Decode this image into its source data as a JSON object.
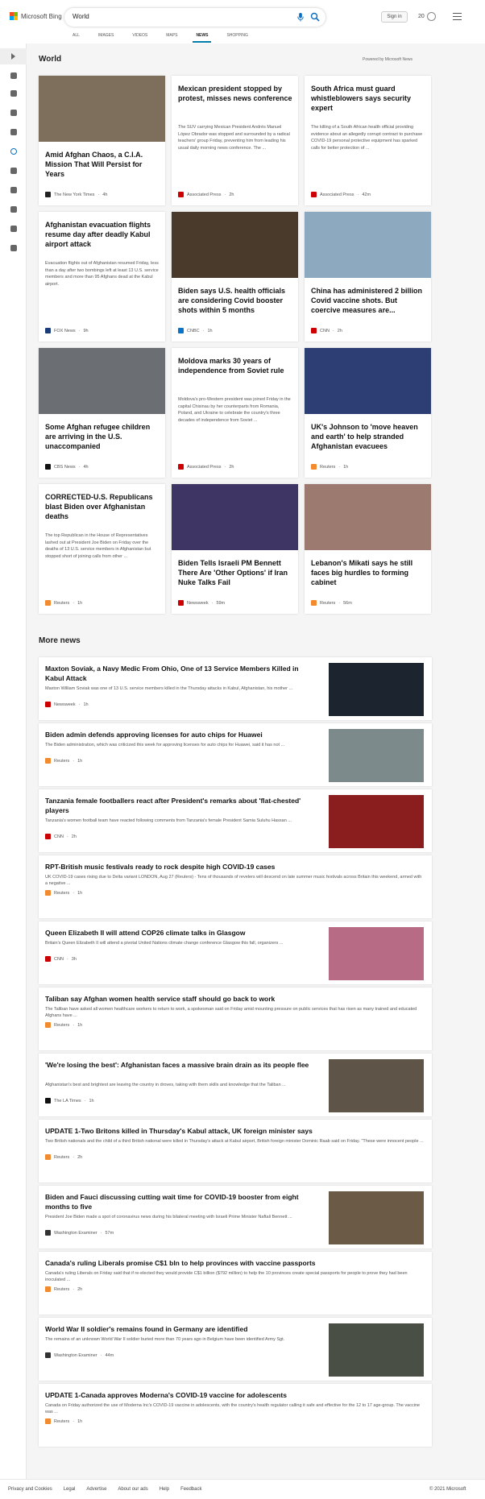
{
  "header": {
    "logo_text": "Microsoft Bing",
    "search_value": "World",
    "signin": "Sign in",
    "rewards_count": "20",
    "tabs": [
      "ALL",
      "IMAGES",
      "VIDEOS",
      "MAPS",
      "NEWS",
      "SHOPPING"
    ],
    "active_tab": "NEWS"
  },
  "world": {
    "title": "World",
    "powered": "Powered by Microsoft News",
    "cards": [
      {
        "title": "Amid Afghan Chaos, a C.I.A. Mission That Will Persist for Years",
        "snippet": "",
        "source": "The New York Times",
        "time": "4h",
        "src_color": "#222",
        "img_color": "#7d6f5b",
        "has_img": true
      },
      {
        "title": "Mexican president stopped by protest, misses news conference",
        "snippet": "The SUV carrying Mexican President Andrés Manuel López Obrador was stopped and surrounded by a radical teachers' group Friday, preventing him from leading his usual daily morning news conference. The ...",
        "source": "Associated Press",
        "time": "2h",
        "src_color": "#c00",
        "has_img": false
      },
      {
        "title": "South Africa must guard whistleblowers says security expert",
        "snippet": "The killing of a South African health official providing evidence about an allegedly corrupt contract to purchase COVID-19 personal protective equipment has sparked calls for better protection of ...",
        "source": "Associated Press",
        "time": "42m",
        "src_color": "#c00",
        "has_img": false
      },
      {
        "title": "Afghanistan evacuation flights resume day after deadly Kabul airport attack",
        "snippet": "Evacuation flights out of Afghanistan resumed Friday, less than a day after two bombings left at least 13 U.S. service members and more than 95 Afghans dead at the Kabul airport.",
        "source": "FOX News",
        "time": "9h",
        "src_color": "#1a3d7a",
        "has_img": false
      },
      {
        "title": "Biden says U.S. health officials are considering Covid booster shots within 5 months",
        "snippet": "",
        "source": "CNBC",
        "time": "1h",
        "src_color": "#0a72c7",
        "img_color": "#4a3a2c",
        "has_img": true
      },
      {
        "title": "China has administered 2 billion Covid vaccine shots. But coercive measures are...",
        "snippet": "",
        "source": "CNN",
        "time": "2h",
        "src_color": "#c00",
        "img_color": "#8da9c0",
        "has_img": true
      },
      {
        "title": "Some Afghan refugee children are arriving in the U.S. unaccompanied",
        "snippet": "",
        "source": "CBS News",
        "time": "4h",
        "src_color": "#111",
        "img_color": "#6b6e72",
        "has_img": true
      },
      {
        "title": "Moldova marks 30 years of independence from Soviet rule",
        "snippet": "Moldova's pro-Western president was joined Friday in the capital Chisinau by her counterparts from Romania, Poland, and Ukraine to celebrate the country's three decades of independence from Soviet ...",
        "source": "Associated Press",
        "time": "2h",
        "src_color": "#c00",
        "has_img": false
      },
      {
        "title": "UK's Johnson to 'move heaven and earth' to help stranded Afghanistan evacuees",
        "snippet": "",
        "source": "Reuters",
        "time": "1h",
        "src_color": "#f28b30",
        "img_color": "#2c3e73",
        "has_img": true
      },
      {
        "title": "CORRECTED-U.S. Republicans blast Biden over Afghanistan deaths",
        "snippet": "The top Republican in the House of Representatives lashed out at President Joe Biden on Friday over the deaths of 13 U.S. service members in Afghanistan but stopped short of joining calls from other ...",
        "source": "Reuters",
        "time": "1h",
        "src_color": "#f28b30",
        "has_img": false
      },
      {
        "title": "Biden Tells Israeli PM Bennett There Are 'Other Options' if Iran Nuke Talks Fail",
        "snippet": "",
        "source": "Newsweek",
        "time": "59m",
        "src_color": "#c00",
        "img_color": "#3e3565",
        "has_img": true
      },
      {
        "title": "Lebanon's Mikati says he still faces big hurdles to forming cabinet",
        "snippet": "",
        "source": "Reuters",
        "time": "56m",
        "src_color": "#f28b30",
        "img_color": "#9c7a70",
        "has_img": true
      }
    ]
  },
  "more": {
    "title": "More news",
    "items": [
      {
        "title": "Maxton Soviak, a Navy Medic From Ohio, One of 13 Service Members Killed in Kabul Attack",
        "snippet": "Maxton William Soviak was one of 13 U.S. service members killed in the Thursday attacks in Kabul, Afghanistan, his mother ...",
        "source": "Newsweek",
        "time": "1h",
        "src_color": "#c00",
        "img_color": "#1c2430",
        "has_img": true
      },
      {
        "title": "Biden admin defends approving licenses for auto chips for Huawei",
        "snippet": "The Biden administration, which was criticized this week for approving licenses for auto chips for Huawei, said it has not ...",
        "source": "Reuters",
        "time": "1h",
        "src_color": "#f28b30",
        "img_color": "#7c8a8c",
        "has_img": true
      },
      {
        "title": "Tanzania female footballers react after President's remarks about 'flat-chested' players",
        "snippet": "Tanzania's women football team have reacted following comments from Tanzania's female President Samia Suluhu Hassan ...",
        "source": "CNN",
        "time": "2h",
        "src_color": "#c00",
        "img_color": "#8a1d1d",
        "has_img": true
      },
      {
        "title": "RPT-British music festivals ready to rock despite high COVID-19 cases",
        "snippet": "UK COVID-19 cases rising due to Delta variant LONDON, Aug 27 (Reuters) - Tens of thousands of revelers will descend on late summer music festivals across Britain this weekend, armed with a negative ...",
        "source": "Reuters",
        "time": "1h",
        "src_color": "#f28b30",
        "has_img": false
      },
      {
        "title": "Queen Elizabeth II will attend COP26 climate talks in Glasgow",
        "snippet": "Britain's Queen Elizabeth II will attend a pivotal United Nations climate change conference Glasgow this fall, organizers ...",
        "source": "CNN",
        "time": "3h",
        "src_color": "#c00",
        "img_color": "#b86b85",
        "has_img": true
      },
      {
        "title": "Taliban say Afghan women health service staff should go back to work",
        "snippet": "The Taliban have asked all women healthcare workers to return to work, a spokesman said on Friday amid mounting pressure on public services that has risen as many trained and educated Afghans have ...",
        "source": "Reuters",
        "time": "1h",
        "src_color": "#f28b30",
        "has_img": false
      },
      {
        "title": "'We're losing the best': Afghanistan faces a massive brain drain as its people flee",
        "snippet": "Afghanistan's best and brightest are leaving the country in droves, taking with them skills and knowledge that the Taliban ...",
        "source": "The LA Times",
        "time": "1h",
        "src_color": "#111",
        "img_color": "#5e5447",
        "has_img": true
      },
      {
        "title": "UPDATE 1-Two Britons killed in Thursday's Kabul attack, UK foreign minister says",
        "snippet": "Two British nationals and the child of a third British national were killed in Thursday's attack at Kabul airport, British foreign minister Dominic Raab said on Friday. \"These were innocent people ...",
        "source": "Reuters",
        "time": "2h",
        "src_color": "#f28b30",
        "has_img": false
      },
      {
        "title": "Biden and Fauci discussing cutting wait time for COVID-19 booster from eight months to five",
        "snippet": "President Joe Biden made a spot of coronavirus news during his bilateral meeting with Israeli Prime Minister Naftali Bennett ...",
        "source": "Washington Examiner",
        "time": "57m",
        "src_color": "#333",
        "img_color": "#6b5a45",
        "has_img": true
      },
      {
        "title": "Canada's ruling Liberals promise C$1 bln to help provinces with vaccine passports",
        "snippet": "Canada's ruling Liberals on Friday said that if re-elected they would provide C$1 billion ($792 million) to help the 10 provinces create special passports for people to prove they had been inoculated ...",
        "source": "Reuters",
        "time": "2h",
        "src_color": "#f28b30",
        "has_img": false
      },
      {
        "title": "World War II soldier's remains found in Germany are identified",
        "snippet": "The remains of an unknown World War II soldier buried more than 70 years ago in Belgium have been identified Army Sgt.",
        "source": "Washington Examiner",
        "time": "44m",
        "src_color": "#333",
        "img_color": "#4a4f45",
        "has_img": true
      },
      {
        "title": "UPDATE 1-Canada approves Moderna's COVID-19 vaccine for adolescents",
        "snippet": "Canada on Friday authorized the use of Moderna Inc's COVID-19 vaccine in adolescents, with the country's health regulator calling it safe and effective for the 12 to 17 age-group. The vaccine was ...",
        "source": "Reuters",
        "time": "1h",
        "src_color": "#f28b30",
        "has_img": false
      }
    ]
  },
  "footer": {
    "links": [
      "Privacy and Cookies",
      "Legal",
      "Advertise",
      "About our ads",
      "Help",
      "Feedback"
    ],
    "copyright": "© 2021 Microsoft"
  }
}
